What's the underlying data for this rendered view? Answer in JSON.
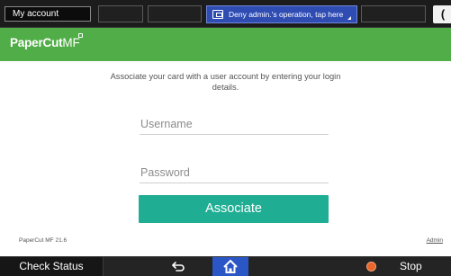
{
  "topbar": {
    "account_label": "My account",
    "notice_text": "Deny admin.'s operation, tap here",
    "notice_color": "#2f4cb3",
    "moon_glyph": "("
  },
  "header": {
    "logo_text": "PaperCut",
    "logo_suffix": "MF",
    "brand_color": "#51ad47"
  },
  "main": {
    "intro_text": "Associate your card with a user account by entering your login details.",
    "username_placeholder": "Username",
    "password_placeholder": "Password",
    "associate_label": "Associate",
    "button_color": "#1fae94"
  },
  "footer": {
    "version": "PaperCut MF 21.6",
    "admin_link": "Admin"
  },
  "bottombar": {
    "check_status_label": "Check Status",
    "stop_label": "Stop",
    "back_icon": "back-arrow-icon",
    "home_icon": "home-icon",
    "stop_icon": "stop-icon",
    "home_color": "#2b56c6",
    "stop_color": "#e8662c"
  }
}
